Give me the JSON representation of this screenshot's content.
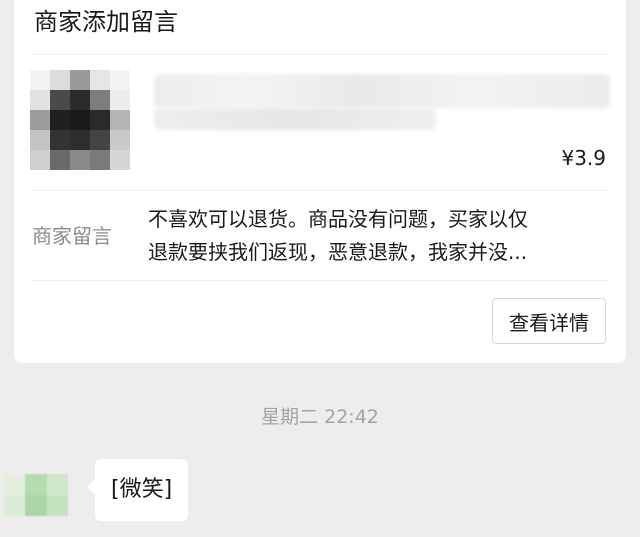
{
  "card": {
    "title": "商家添加留言",
    "price": "¥3.9",
    "message_label": "商家留言",
    "message_lines": [
      "不喜欢可以退货。商品没有问题，买家以仅",
      "退款要挟我们返现，恶意退款，我家并没..."
    ],
    "detail_button": "查看详情"
  },
  "chat": {
    "timestamp": "星期二 22:42",
    "message": "[微笑]"
  },
  "colors": {
    "background": "#ededed",
    "card": "#ffffff",
    "label_gray": "#8c8c8c",
    "timestamp_gray": "#a3a3a3"
  }
}
